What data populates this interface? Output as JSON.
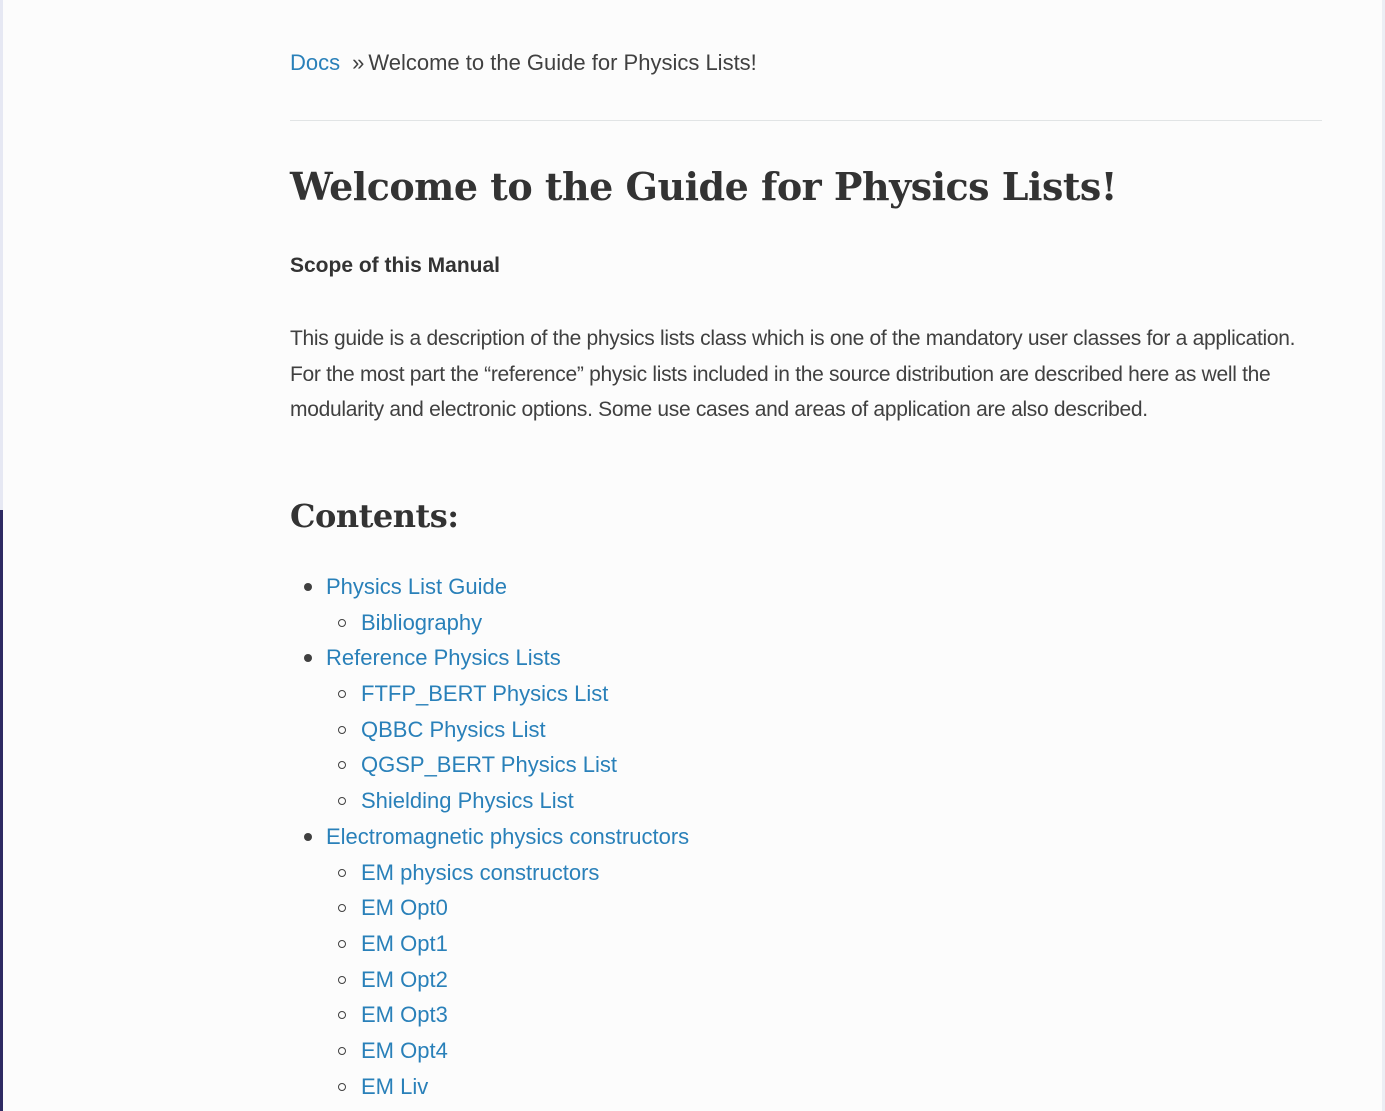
{
  "breadcrumb": {
    "home": "Docs",
    "separator": "»",
    "current": "Welcome to the Guide for Physics Lists!"
  },
  "page": {
    "title": "Welcome to the Guide for Physics Lists!",
    "scope_heading": "Scope of this Manual",
    "intro": "This guide is a description of the physics lists class which is one of the mandatory user classes for a application. For the most part the “reference” physic lists included in the source distribution are described here as well the modularity and electronic options. Some use cases and areas of application are also described.",
    "contents_heading": "Contents:"
  },
  "toc": {
    "items": [
      {
        "label": "Physics List Guide",
        "level": 1
      },
      {
        "label": "Bibliography",
        "level": 2
      },
      {
        "label": "Reference Physics Lists",
        "level": 1
      },
      {
        "label": "FTFP_BERT Physics List",
        "level": 2
      },
      {
        "label": "QBBC Physics List",
        "level": 2
      },
      {
        "label": "QGSP_BERT Physics List",
        "level": 2
      },
      {
        "label": "Shielding Physics List",
        "level": 2
      },
      {
        "label": "Electromagnetic physics constructors",
        "level": 1
      },
      {
        "label": "EM physics constructors",
        "level": 2
      },
      {
        "label": "EM Opt0",
        "level": 2
      },
      {
        "label": "EM Opt1",
        "level": 2
      },
      {
        "label": "EM Opt2",
        "level": 2
      },
      {
        "label": "EM Opt3",
        "level": 2
      },
      {
        "label": "EM Opt4",
        "level": 2
      },
      {
        "label": "EM Liv",
        "level": 2
      }
    ]
  },
  "colors": {
    "link": "#2980b9",
    "text": "#404040",
    "heading": "#333333",
    "background": "#fcfcfc",
    "sidebar_dark": "#2f2a63"
  }
}
